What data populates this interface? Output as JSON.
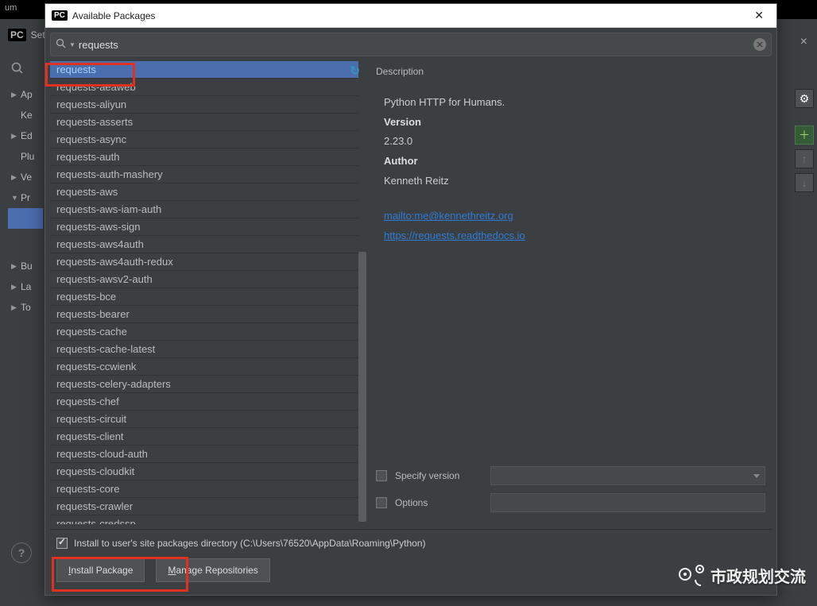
{
  "bg": {
    "title_suffix": "um",
    "settings_label": "Set",
    "close_tab": "×",
    "gear": "⚙",
    "plus": "＋",
    "up": "↑",
    "down": "↓",
    "tree": [
      {
        "arrow": "▶",
        "label": "Ap"
      },
      {
        "arrow": "",
        "label": "Ke"
      },
      {
        "arrow": "▶",
        "label": "Ed"
      },
      {
        "arrow": "",
        "label": "Plu"
      },
      {
        "arrow": "▶",
        "label": "Ve"
      },
      {
        "arrow": "▼",
        "label": "Pr",
        "sel": true
      },
      {
        "arrow": "",
        "label": ""
      },
      {
        "arrow": "▶",
        "label": "Bu"
      },
      {
        "arrow": "▶",
        "label": "La"
      },
      {
        "arrow": "▶",
        "label": "To"
      }
    ],
    "help": "?"
  },
  "dialog": {
    "title": "Available Packages",
    "close": "✕",
    "search_value": "requests",
    "refresh_icon": "↻",
    "packages": [
      "requests",
      "requests-aeaweb",
      "requests-aliyun",
      "requests-asserts",
      "requests-async",
      "requests-auth",
      "requests-auth-mashery",
      "requests-aws",
      "requests-aws-iam-auth",
      "requests-aws-sign",
      "requests-aws4auth",
      "requests-aws4auth-redux",
      "requests-awsv2-auth",
      "requests-bce",
      "requests-bearer",
      "requests-cache",
      "requests-cache-latest",
      "requests-ccwienk",
      "requests-celery-adapters",
      "requests-chef",
      "requests-circuit",
      "requests-client",
      "requests-cloud-auth",
      "requests-cloudkit",
      "requests-core",
      "requests-crawler",
      "requests-credssp"
    ],
    "desc": {
      "heading": "Description",
      "summary": "Python HTTP for Humans.",
      "version_label": "Version",
      "version": "2.23.0",
      "author_label": "Author",
      "author": "Kenneth Reitz",
      "link1": "mailto:me@kennethreitz.org",
      "link2": "https://requests.readthedocs.io"
    },
    "specify_version": "Specify version",
    "options_label": "Options",
    "install_to_user": "Install to user's site packages directory (C:\\Users\\76520\\AppData\\Roaming\\Python)",
    "install_btn_pre": "I",
    "install_btn": "nstall Package",
    "manage_btn_pre": "M",
    "manage_btn": "anage Repositories"
  },
  "watermark": "市政规划交流"
}
